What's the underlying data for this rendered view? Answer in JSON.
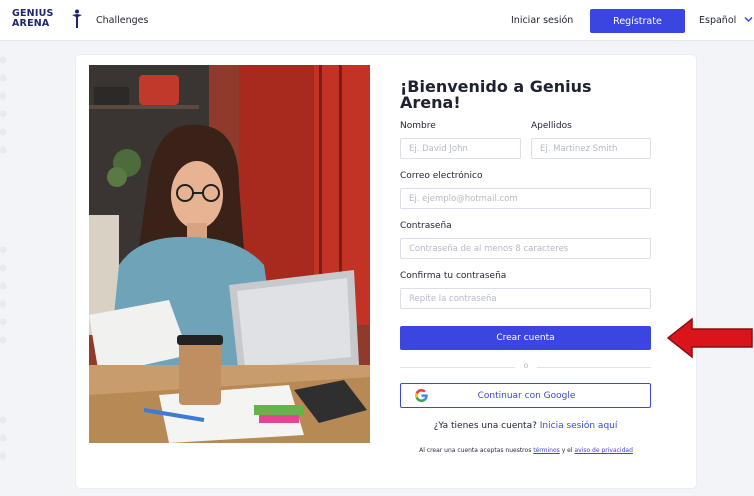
{
  "header": {
    "logo_line1": "GENIUS",
    "logo_line2": "ARENA",
    "nav_challenges": "Challenges",
    "login_label": "Iniciar sesión",
    "register_label": "Regístrate",
    "language": "Español"
  },
  "form": {
    "title": "¡Bienvenido a Genius Arena!",
    "first_name_label": "Nombre",
    "first_name_placeholder": "Ej. David John",
    "last_name_label": "Apellidos",
    "last_name_placeholder": "Ej. Martinez Smith",
    "email_label": "Correo electrónico",
    "email_placeholder": "Ej. ejemplo@hotmail.com",
    "password_label": "Contraseña",
    "password_placeholder": "Contraseña de al menos 8 caracteres",
    "confirm_label": "Confirma tu contraseña",
    "confirm_placeholder": "Repite la contraseña",
    "create_button": "Crear cuenta",
    "divider": "o",
    "google_button": "Continuar con Google",
    "have_account": "¿Ya tienes una cuenta?",
    "login_here": "Inicia sesión aquí",
    "terms_prefix": "Al crear una cuenta aceptas nuestros",
    "terms_link": "términos",
    "terms_and": "y el",
    "privacy_link": "aviso de privacidad"
  },
  "colors": {
    "brand_navy": "#1e2670",
    "accent_blue": "#3b46e0",
    "arrow_red": "#d9141b",
    "page_bg": "#f3f4f7"
  },
  "icons": [
    "logo-figure-icon",
    "chevron-down-icon",
    "google-g-icon",
    "red-arrow-icon"
  ]
}
